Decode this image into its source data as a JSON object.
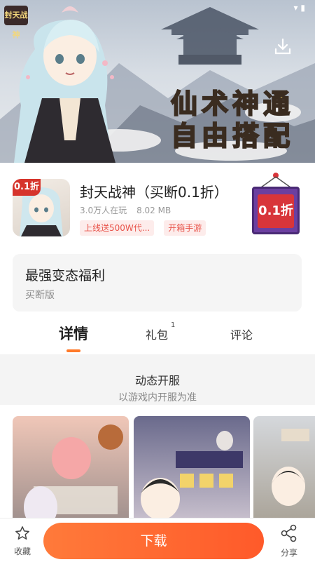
{
  "hero": {
    "corner_logo": "封天战神",
    "line1": "仙术神通",
    "line2": "自由搭配",
    "download_icon": "download-icon"
  },
  "app": {
    "badge": "0.1折",
    "title": "封天战神（买断0.1折）",
    "players": "3.0万人在玩",
    "size": "8.02 MB",
    "tags": [
      "上线送500W代...",
      "开箱手游"
    ],
    "discount": "0.1折"
  },
  "welfare": {
    "title": "最强变态福利",
    "subtitle": "买断版"
  },
  "tabs": [
    {
      "label": "详情",
      "active": true
    },
    {
      "label": "礼包",
      "sup": "1"
    },
    {
      "label": "评论"
    }
  ],
  "server": {
    "title": "动态开服",
    "subtitle": "以游戏内开服为准"
  },
  "bottombar": {
    "favorite_label": "收藏",
    "download_label": "下载",
    "share_label": "分享"
  },
  "colors": {
    "accent": "#ff6a30",
    "tag_text": "#e8534a",
    "tag_bg": "#fdeceb"
  }
}
